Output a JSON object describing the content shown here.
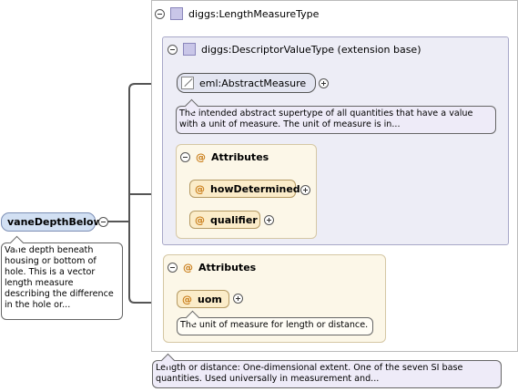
{
  "root": {
    "label": "vaneDepthBelow",
    "doc": "Vane depth beneath housing or bottom of hole. This is a vector length measure describing the difference in the hole or..."
  },
  "type": {
    "label": "diggs:LengthMeasureType",
    "doc": "Length or distance: One-dimensional extent. One of the seven SI base quantities. Used universally in measurement and..."
  },
  "extension": {
    "label": "diggs:DescriptorValueType (extension base)",
    "element": {
      "label": "eml:AbstractMeasure",
      "doc": "The intended abstract supertype of all quantities that have a value with a unit of measure. The unit of measure is in..."
    },
    "attributes": {
      "title": "Attributes",
      "symbol": "@",
      "items": [
        {
          "label": "howDetermined"
        },
        {
          "label": "qualifier"
        }
      ]
    }
  },
  "own_attributes": {
    "title": "Attributes",
    "symbol": "@",
    "items": [
      {
        "label": "uom",
        "doc": "The unit of measure for length or distance."
      }
    ]
  }
}
